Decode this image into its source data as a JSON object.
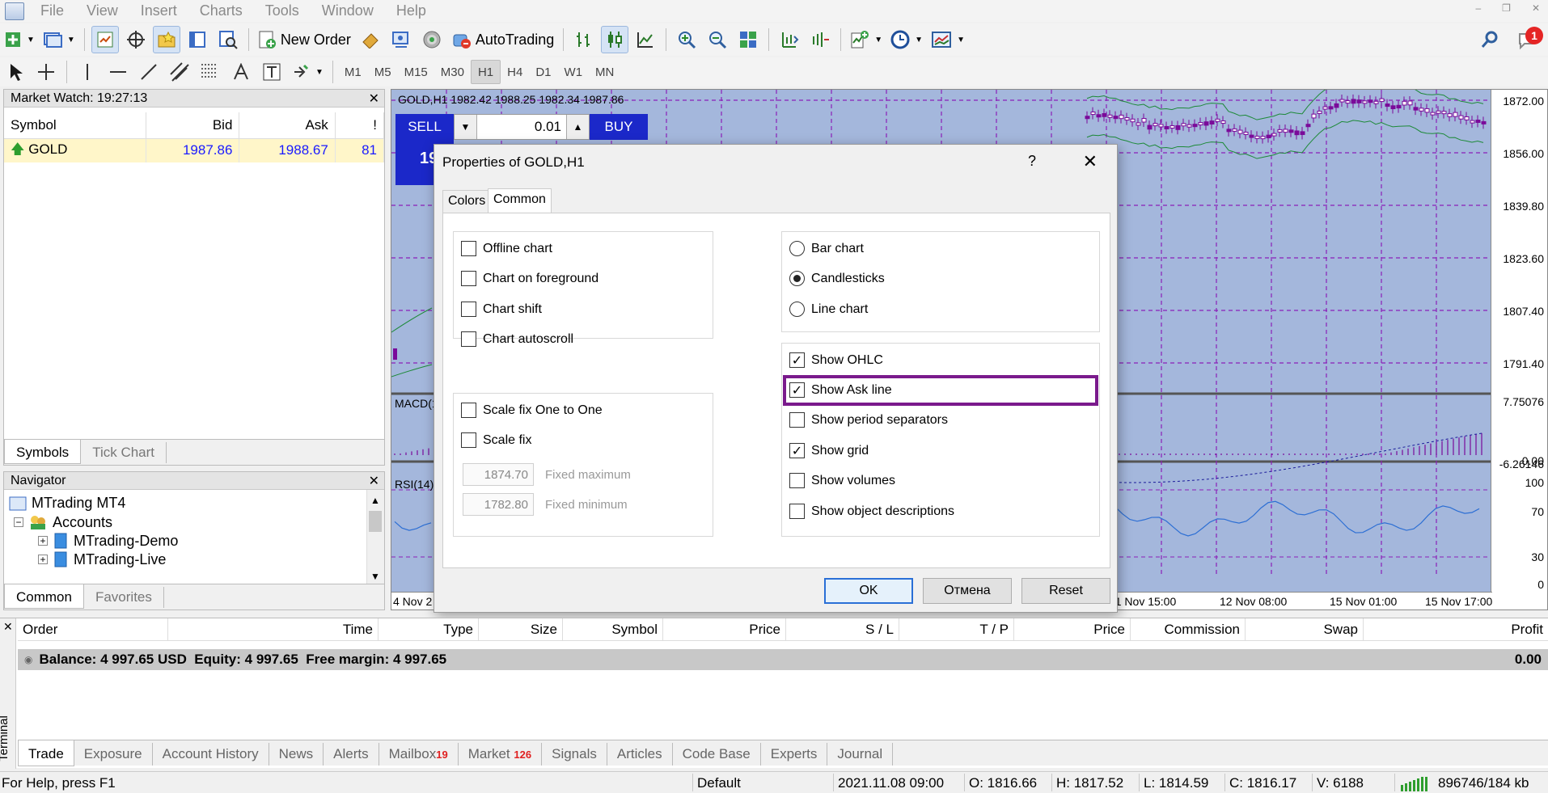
{
  "menu": [
    "File",
    "View",
    "Insert",
    "Charts",
    "Tools",
    "Window",
    "Help"
  ],
  "toolbar": {
    "new_order": "New Order",
    "autotrading": "AutoTrading",
    "notification_count": "1"
  },
  "timeframes": [
    "M1",
    "M5",
    "M15",
    "M30",
    "H1",
    "H4",
    "D1",
    "W1",
    "MN"
  ],
  "active_timeframe": "H1",
  "market_watch": {
    "title": "Market Watch: 19:27:13",
    "columns": [
      "Symbol",
      "Bid",
      "Ask",
      "!"
    ],
    "rows": [
      {
        "symbol": "GOLD",
        "bid": "1987.86",
        "ask": "1988.67",
        "spread": "81"
      }
    ],
    "tabs": [
      "Symbols",
      "Tick Chart"
    ]
  },
  "navigator": {
    "title": "Navigator",
    "root": "MTrading MT4",
    "accounts": "Accounts",
    "demo": "MTrading-Demo",
    "live": "MTrading-Live",
    "tabs": [
      "Common",
      "Favorites"
    ]
  },
  "chart": {
    "title": "GOLD,H1  1982.42 1988.25 1982.34 1987.86",
    "sell": "SELL",
    "buy": "BUY",
    "lot": "0.01",
    "bid_fragment": "19",
    "prices": [
      "1872.00",
      "1856.00",
      "1839.80",
      "1823.60",
      "1807.40",
      "1791.40"
    ],
    "macd_label": "MACD(1",
    "macd_prices": [
      "7.75076",
      "0.00",
      "-6.26146"
    ],
    "rsi_label": "RSI(14)",
    "rsi_levels": [
      "100",
      "70",
      "30",
      "0"
    ],
    "times": [
      "4 Nov 2",
      "11 Nov 15:00",
      "12 Nov 08:00",
      "15 Nov 01:00",
      "15 Nov 17:00"
    ]
  },
  "dialog": {
    "title": "Properties of GOLD,H1",
    "help": "?",
    "tabs": [
      "Colors",
      "Common"
    ],
    "left_options": [
      "Offline chart",
      "Chart on foreground",
      "Chart shift",
      "Chart autoscroll"
    ],
    "scale_options": [
      "Scale fix One to One",
      "Scale fix"
    ],
    "fixed_max_value": "1874.70",
    "fixed_max_label": "Fixed maximum",
    "fixed_min_value": "1782.80",
    "fixed_min_label": "Fixed minimum",
    "chart_types": [
      "Bar chart",
      "Candlesticks",
      "Line chart"
    ],
    "selected_chart_type": "Candlesticks",
    "show_options": [
      "Show OHLC",
      "Show Ask line",
      "Show period separators",
      "Show grid",
      "Show volumes",
      "Show object descriptions"
    ],
    "checked_show_options": [
      "Show OHLC",
      "Show Ask line",
      "Show grid"
    ],
    "buttons": {
      "ok": "OK",
      "cancel": "Отмена",
      "reset": "Reset"
    }
  },
  "terminal": {
    "columns": [
      "Order",
      "Time",
      "Type",
      "Size",
      "Symbol",
      "Price",
      "S / L",
      "T / P",
      "Price",
      "Commission",
      "Swap",
      "Profit"
    ],
    "balance_text": "Balance: 4 997.65 USD  Equity: 4 997.65  Free margin: 4 997.65",
    "profit_total": "0.00",
    "side_label": "Terminal",
    "tabs": [
      {
        "label": "Trade",
        "count": ""
      },
      {
        "label": "Exposure",
        "count": ""
      },
      {
        "label": "Account History",
        "count": ""
      },
      {
        "label": "News",
        "count": ""
      },
      {
        "label": "Alerts",
        "count": ""
      },
      {
        "label": "Mailbox",
        "count": "19"
      },
      {
        "label": "Market",
        "count": "126"
      },
      {
        "label": "Signals",
        "count": ""
      },
      {
        "label": "Articles",
        "count": ""
      },
      {
        "label": "Code Base",
        "count": ""
      },
      {
        "label": "Experts",
        "count": ""
      },
      {
        "label": "Journal",
        "count": ""
      }
    ]
  },
  "status": {
    "help": "For Help, press F1",
    "profile": "Default",
    "datetime": "2021.11.08 09:00",
    "open": "O: 1816.66",
    "high": "H: 1817.52",
    "low": "L: 1814.59",
    "close": "C: 1816.17",
    "volume": "V: 6188",
    "traffic": "896746/184 kb"
  },
  "colors": {
    "chart_bg": "#a4b7dc",
    "grid": "#8b1fb8",
    "candle": "#7a0a9a",
    "bands": "#1d8a38",
    "rsi_line": "#2d6fd4",
    "highlight": "#7a1a8c",
    "trade_button": "#1b28c9"
  }
}
